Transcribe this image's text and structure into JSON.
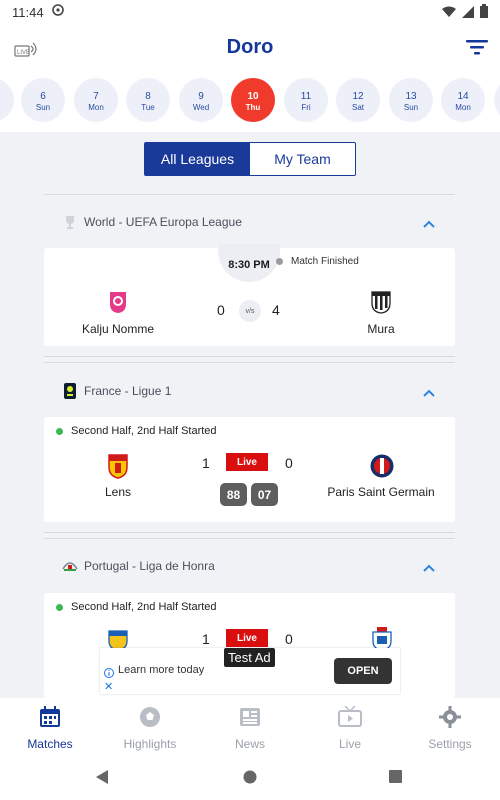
{
  "status_bar": {
    "time": "11:44"
  },
  "app": {
    "title": "Doro"
  },
  "dates": [
    {
      "num": "",
      "day": ""
    },
    {
      "num": "6",
      "day": "Sun"
    },
    {
      "num": "7",
      "day": "Mon"
    },
    {
      "num": "8",
      "day": "Tue"
    },
    {
      "num": "9",
      "day": "Wed"
    },
    {
      "num": "10",
      "day": "Thu",
      "active": true
    },
    {
      "num": "11",
      "day": "Fri"
    },
    {
      "num": "12",
      "day": "Sat"
    },
    {
      "num": "13",
      "day": "Sun"
    },
    {
      "num": "14",
      "day": "Mon"
    },
    {
      "num": "",
      "day": ""
    }
  ],
  "toggle": {
    "all": "All Leagues",
    "mine": "My Team"
  },
  "leagues": [
    {
      "name": "World - UEFA Europa League",
      "match": {
        "time": "8:30 PM",
        "status": "Match Finished",
        "home": "Kalju Nomme",
        "away": "Mura",
        "home_score": "0",
        "away_score": "4",
        "vs": "v/s"
      }
    },
    {
      "name": "France - Ligue 1",
      "match": {
        "status": "Second Half, 2nd Half Started",
        "home": "Lens",
        "away": "Paris Saint Germain",
        "home_score": "1",
        "away_score": "0",
        "live": "Live",
        "minute_a": "88",
        "minute_b": "07"
      }
    },
    {
      "name": "Portugal - Liga de Honra",
      "match": {
        "status": "Second Half, 2nd Half Started",
        "home_score": "1",
        "away_score": "0",
        "live": "Live"
      }
    }
  ],
  "ad": {
    "tag": "Test Ad",
    "text": "Learn more today",
    "button": "OPEN"
  },
  "nav": [
    {
      "label": "Matches",
      "icon": "calendar-icon",
      "active": true
    },
    {
      "label": "Highlights",
      "icon": "soccer-ball-icon"
    },
    {
      "label": "News",
      "icon": "newspaper-icon"
    },
    {
      "label": "Live",
      "icon": "tv-icon"
    },
    {
      "label": "Settings",
      "icon": "gear-icon"
    }
  ],
  "colors": {
    "brand": "#14379a",
    "live": "#d90f0f",
    "active_date": "#f03a2c",
    "status_dot": "#3cba54"
  }
}
